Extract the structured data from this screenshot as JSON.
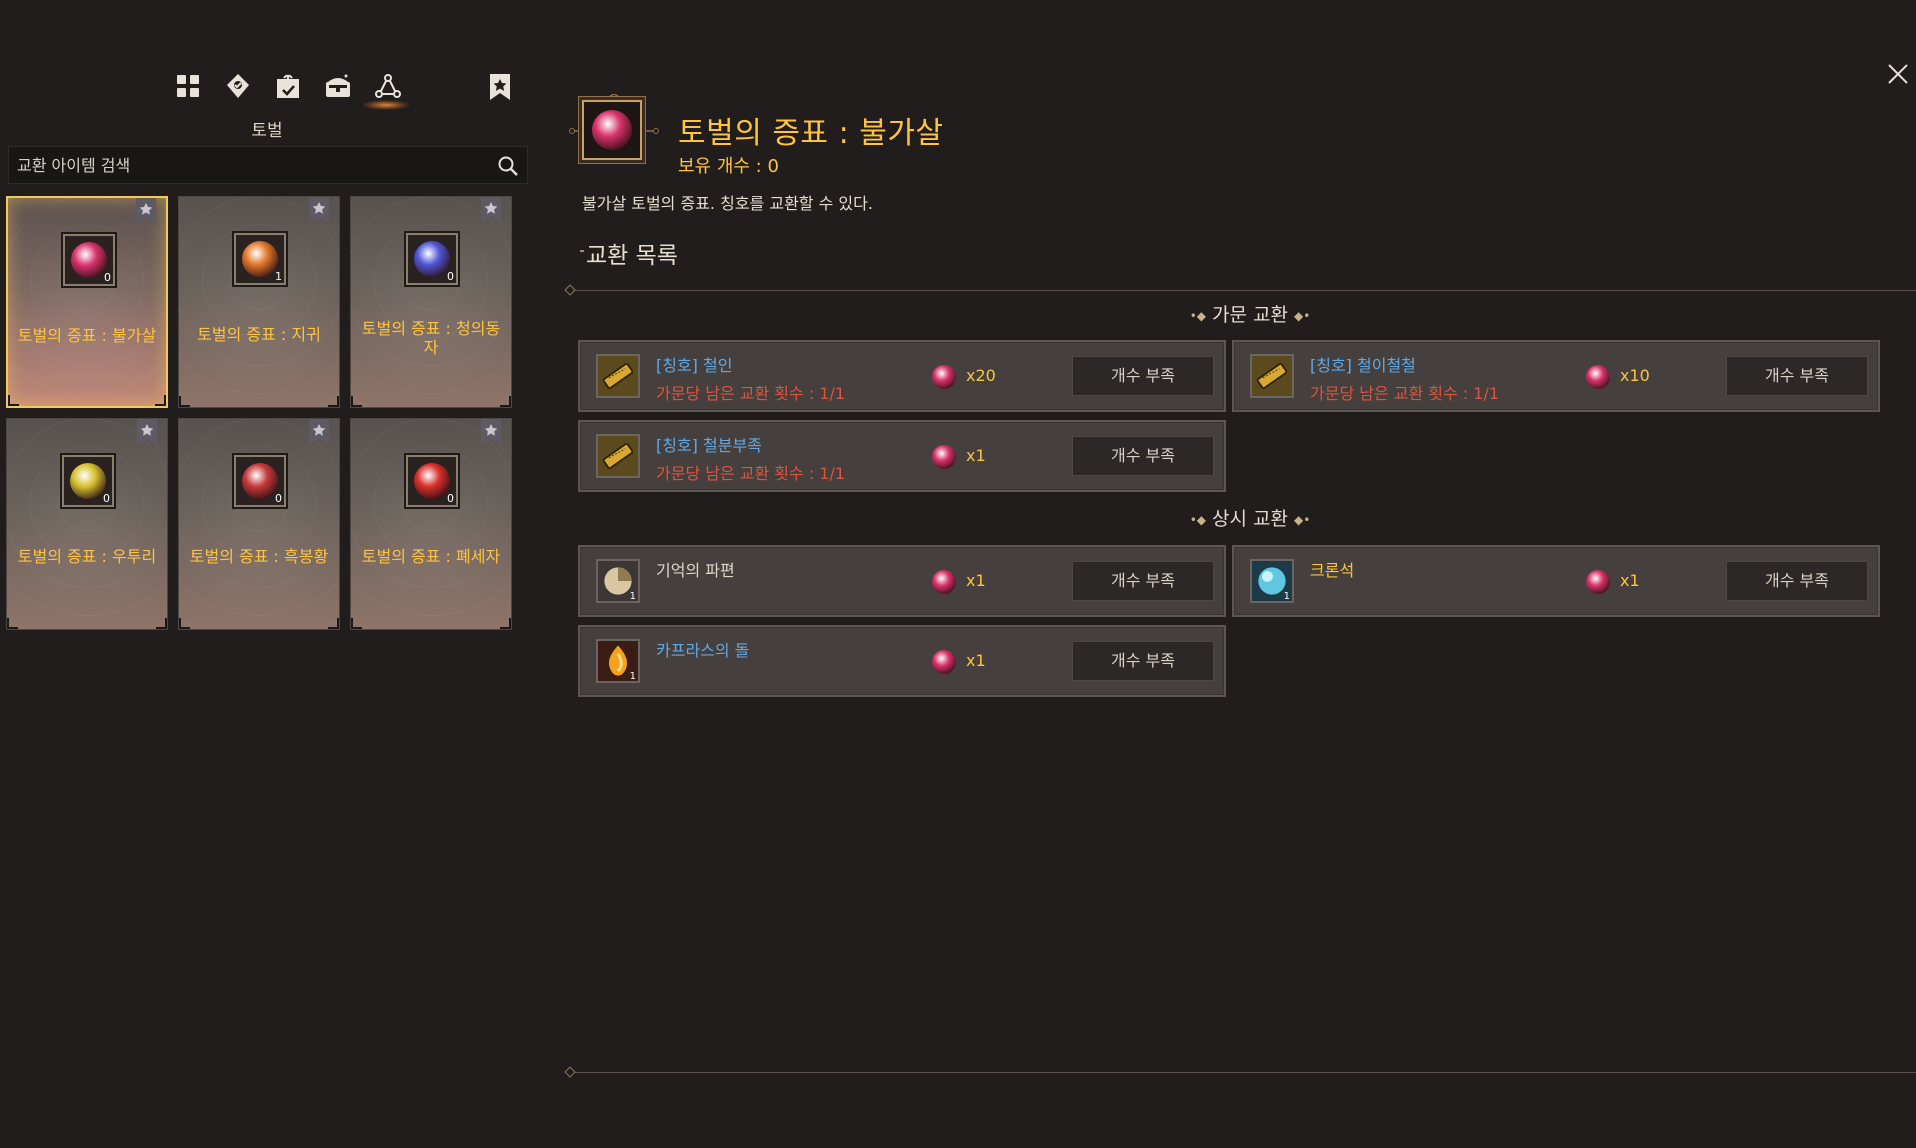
{
  "sidebar": {
    "tabs": [
      {
        "name": "grid-icon"
      },
      {
        "name": "map-pin-icon"
      },
      {
        "name": "gift-icon"
      },
      {
        "name": "chest-icon"
      },
      {
        "name": "network-icon",
        "active": true
      }
    ],
    "bookmark_icon": "bookmark-star-icon",
    "category_label": "토벌",
    "search": {
      "placeholder": "교환 아이템 검색",
      "value": ""
    },
    "cards": [
      {
        "title": "토벌의 증표 : 불가살",
        "qty": "0",
        "gem_color": "#d8336c",
        "selected": true
      },
      {
        "title": "토벌의 증표 : 지귀",
        "qty": "1",
        "gem_color": "#e3782a",
        "selected": false
      },
      {
        "title": "토벌의 증표 : 청의동자",
        "qty": "0",
        "gem_color": "#4f58d6",
        "selected": false
      },
      {
        "title": "토벌의 증표 : 우투리",
        "qty": "0",
        "gem_color": "#d6c22e",
        "selected": false
      },
      {
        "title": "토벌의 증표 : 흑봉황",
        "qty": "0",
        "gem_color": "#c63a3a",
        "selected": false
      },
      {
        "title": "토벌의 증표 : 폐세자",
        "qty": "0",
        "gem_color": "#d9302b",
        "selected": false
      }
    ]
  },
  "detail": {
    "title": "토벌의 증표 : 불가살",
    "owned": "보유 개수 : 0",
    "description": "불가살 토벌의 증표. 칭호를 교환할 수 있다.",
    "exchange_list_label": "교환 목록",
    "icon_color": "#d8336c"
  },
  "sections": [
    {
      "title": "가문 교환",
      "rows": [
        {
          "name": "[칭호] 철인",
          "limit": "가문당 남은 교환 횟수 : 1/1",
          "cost": "x20",
          "button": "개수 부족",
          "name_style": "blue",
          "icon": "scroll-icon",
          "qty": ""
        },
        {
          "name": "[칭호] 철이철철",
          "limit": "가문당 남은 교환 횟수 : 1/1",
          "cost": "x10",
          "button": "개수 부족",
          "name_style": "blue",
          "icon": "scroll-icon",
          "qty": ""
        },
        {
          "name": "[칭호] 철분부족",
          "limit": "가문당 남은 교환 횟수 : 1/1",
          "cost": "x1",
          "button": "개수 부족",
          "name_style": "blue",
          "icon": "scroll-icon",
          "qty": ""
        }
      ]
    },
    {
      "title": "상시 교환",
      "rows": [
        {
          "name": "기억의 파편",
          "limit": "",
          "cost": "x1",
          "button": "개수 부족",
          "name_style": "white",
          "icon": "memory-shard-icon",
          "qty": "1"
        },
        {
          "name": "크론석",
          "limit": "",
          "cost": "x1",
          "button": "개수 부족",
          "name_style": "yellow",
          "icon": "cron-stone-icon",
          "qty": "1"
        },
        {
          "name": "카프라스의 돌",
          "limit": "",
          "cost": "x1",
          "button": "개수 부족",
          "name_style": "blue",
          "icon": "caphras-stone-icon",
          "qty": "1"
        }
      ]
    }
  ],
  "colors": {
    "accent_gold": "#ffc43c",
    "limit_red": "#e0533d",
    "title_blue": "#5fa9e6",
    "background": "#201d1c"
  }
}
